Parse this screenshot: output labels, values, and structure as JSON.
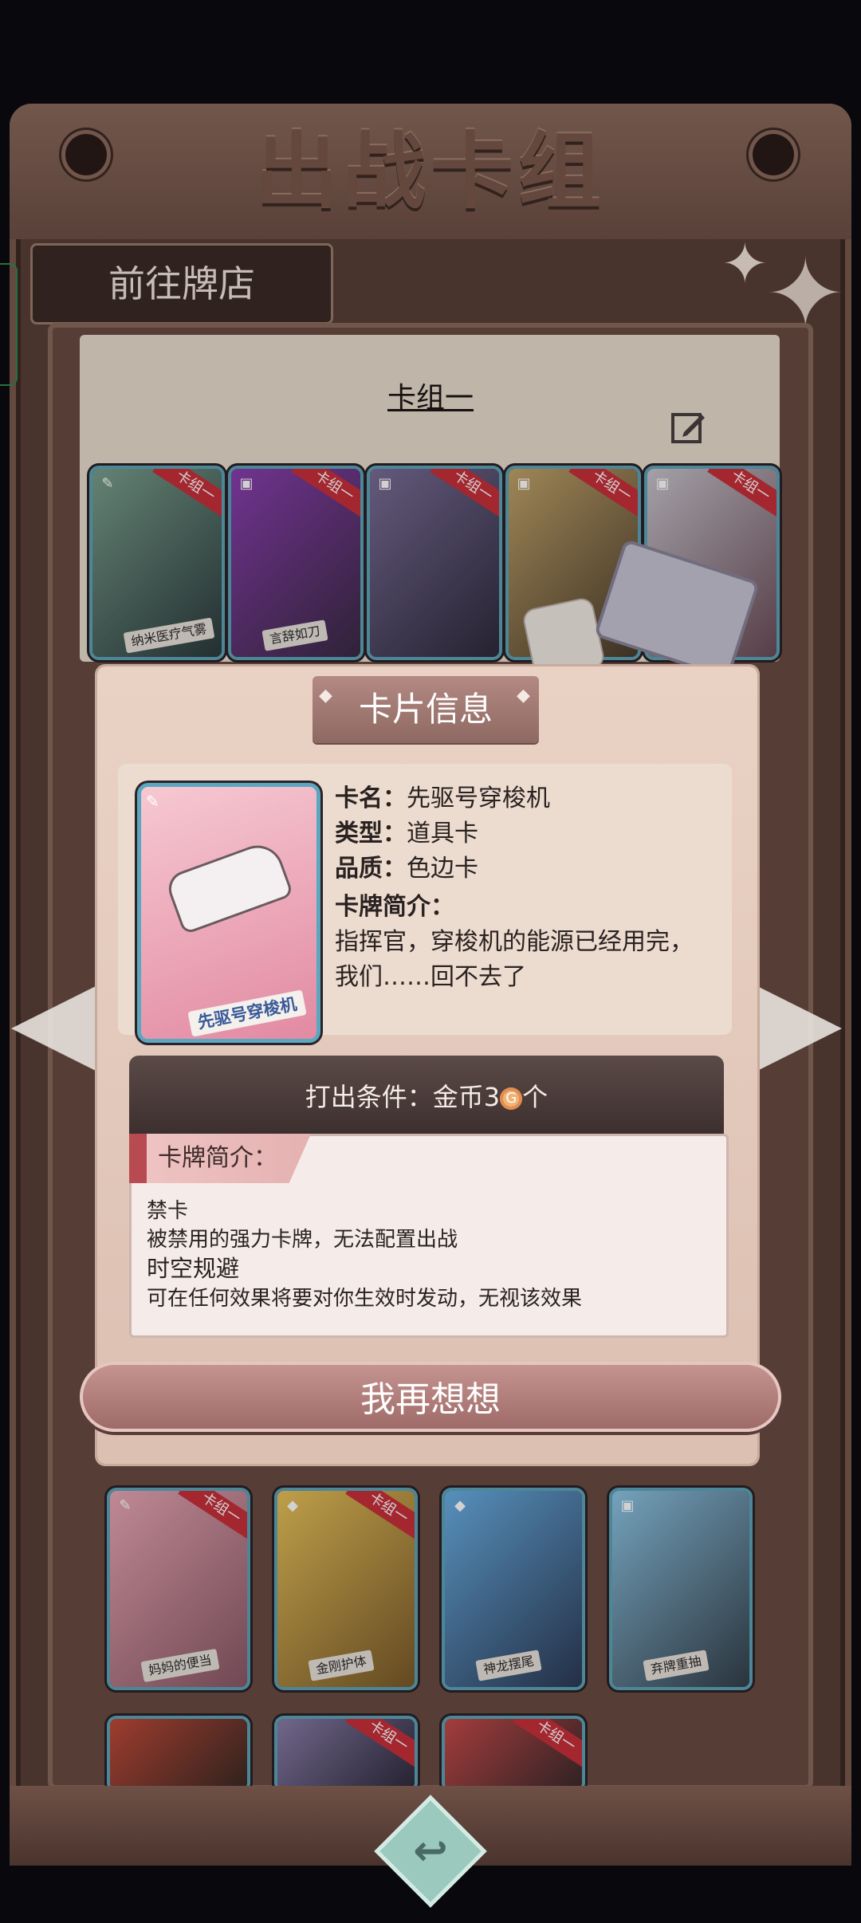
{
  "screen": {
    "title": "出战卡组",
    "shop_button": "前往牌店",
    "deck_name": "卡组一"
  },
  "deck_cards_top": [
    {
      "name": "纳米医疗气雾",
      "ribbon": "卡组一"
    },
    {
      "name": "言辞如刀",
      "ribbon": "卡组一"
    },
    {
      "name": "",
      "ribbon": "卡组一"
    },
    {
      "name": "",
      "ribbon": "卡组一"
    },
    {
      "name": "",
      "ribbon": "卡组一"
    }
  ],
  "deck_cards_bottom": [
    {
      "name": "妈妈的便当",
      "ribbon": "卡组一"
    },
    {
      "name": "金刚护体",
      "ribbon": "卡组一"
    },
    {
      "name": "神龙摆尾",
      "ribbon": ""
    },
    {
      "name": "弃牌重抽",
      "ribbon": ""
    }
  ],
  "deck_cards_partial": [
    {
      "ribbon": ""
    },
    {
      "ribbon": "卡组一"
    },
    {
      "ribbon": "卡组一"
    }
  ],
  "popup": {
    "tab_title": "卡片信息",
    "card_art_label": "先驱号穿梭机",
    "name_label": "卡名：",
    "name_value": "先驱号穿梭机",
    "type_label": "类型：",
    "type_value": "道具卡",
    "quality_label": "品质：",
    "quality_value": "色边卡",
    "intro_label": "卡牌简介：",
    "intro_line1": "指挥官，穿梭机的能源已经用完，",
    "intro_line2": "我们……回不去了",
    "condition_prefix": "打出条件：金币3",
    "condition_suffix": "个",
    "coin_glyph": "G",
    "desc_tab": "卡牌简介：",
    "desc_lines": [
      "禁卡",
      "被禁用的强力卡牌，无法配置出战",
      "时空规避",
      "可在任何效果将要对你生效时发动，无视该效果"
    ],
    "rethink_button": "我再想想"
  },
  "colors": {
    "frame": "#5a4038",
    "card_border": "#5ea4b7",
    "ribbon": "#c8303b",
    "popup_bg": "#e9d2c4",
    "button": "#b38a83"
  },
  "icons": {
    "edit": "edit-icon",
    "back": "back-icon",
    "sparkle": "sparkle-icon",
    "prev": "arrow-left-icon",
    "next": "arrow-right-icon"
  }
}
